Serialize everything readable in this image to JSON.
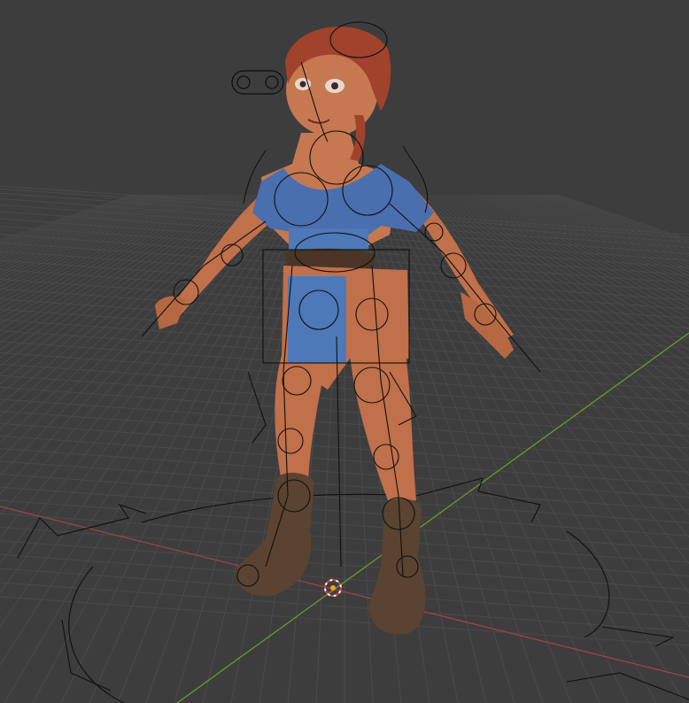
{
  "viewport": {
    "background": "#3d3d3d",
    "grid_color": "#4a4a4a",
    "x_axis_color": "#a0424e",
    "y_axis_color": "#6a9a2e",
    "rig_line_color": "#101010"
  },
  "character": {
    "skin_color": "#c0704a",
    "hair_color": "#a1432c",
    "top_color": "#4a6fae",
    "skirt_color": "#4e79b8",
    "belt_color": "#4a3526",
    "boot_color": "#5a4330"
  },
  "icons": {
    "origin": "3d-cursor-icon",
    "root_control": "root-control-icon",
    "eye_control": "eye-target-control-icon"
  }
}
